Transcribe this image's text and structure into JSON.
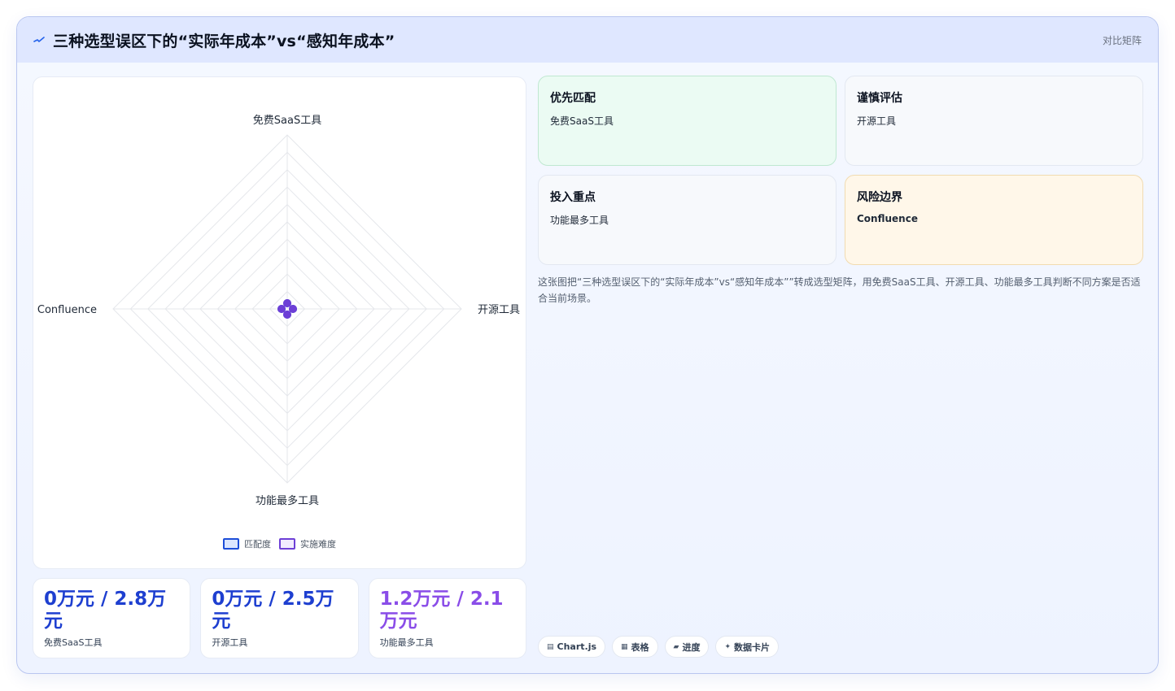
{
  "header": {
    "title": "三种选型误区下的“实际年成本”vs“感知年成本”",
    "tag": "对比矩阵"
  },
  "chart_data": {
    "type": "radar",
    "axes": [
      "免费SaaS工具",
      "开源工具",
      "功能最多工具",
      "Confluence"
    ],
    "rings": 10,
    "range": [
      0,
      100
    ],
    "series": [
      {
        "name": "匹配度",
        "values": [
          0,
          0,
          0,
          0
        ],
        "color": "#1d4ed8"
      },
      {
        "name": "实施难度",
        "values": [
          0,
          0,
          0,
          0
        ],
        "color": "#6d3fd6"
      }
    ],
    "legend_position": "bottom"
  },
  "stats": [
    {
      "value": "0万元 / 2.8万元",
      "label": "免费SaaS工具",
      "color": "#1e3fd0"
    },
    {
      "value": "0万元 / 2.5万元",
      "label": "开源工具",
      "color": "#1e3fd0"
    },
    {
      "value": "1.2万元 / 2.1万元",
      "label": "功能最多工具",
      "color": "#8a4de8"
    }
  ],
  "quadrants": [
    {
      "title": "优先匹配",
      "sub": "免费SaaS工具"
    },
    {
      "title": "谨慎评估",
      "sub": "开源工具"
    },
    {
      "title": "投入重点",
      "sub": "功能最多工具"
    },
    {
      "title": "风险边界",
      "sub": "Confluence"
    }
  ],
  "description": "这张图把“三种选型误区下的“实际年成本”vs“感知年成本””转成选型矩阵，用免费SaaS工具、开源工具、功能最多工具判断不同方案是否适合当前场景。",
  "chips": [
    {
      "icon": "▤",
      "label": "Chart.js"
    },
    {
      "icon": "▦",
      "label": "表格"
    },
    {
      "icon": "▰",
      "label": "进度"
    },
    {
      "icon": "✦",
      "label": "数据卡片"
    }
  ]
}
